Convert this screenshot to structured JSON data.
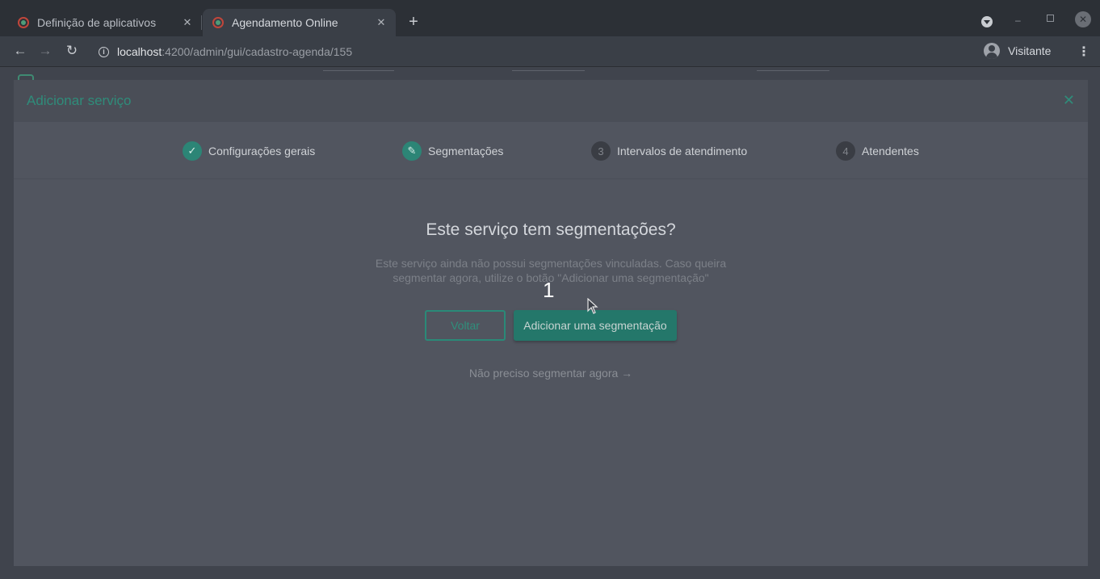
{
  "browser": {
    "tabs": [
      {
        "title": "Definição de aplicativos",
        "close": "✕"
      },
      {
        "title": "Agendamento Online",
        "close": "✕"
      }
    ],
    "new_tab": "+",
    "url_host": "localhost",
    "url_path": ":4200/admin/gui/cadastro-agenda/155",
    "profile_name": "Visitante"
  },
  "modal": {
    "title": "Adicionar serviço",
    "close": "✕",
    "steps": [
      {
        "label": "Configurações gerais",
        "marker": "✓",
        "state": "done"
      },
      {
        "label": "Segmentações",
        "marker": "✎",
        "state": "current"
      },
      {
        "label": "Intervalos de atendimento",
        "marker": "3",
        "state": "pending"
      },
      {
        "label": "Atendentes",
        "marker": "4",
        "state": "pending"
      }
    ],
    "headline": "Este serviço tem segmentações?",
    "description": "Este serviço ainda não possui segmentações vinculadas. Caso queira segmentar agora, utilize o botão \"Adicionar uma segmentação\"",
    "back_button": "Voltar",
    "add_button": "Adicionar uma segmentação",
    "skip_link": "Não preciso segmentar agora",
    "skip_arrow": "→"
  },
  "overlay_label": "1",
  "colors": {
    "accent": "#2f8c7a",
    "primary_button": "#24776a",
    "modal_bg": "#51555f"
  }
}
